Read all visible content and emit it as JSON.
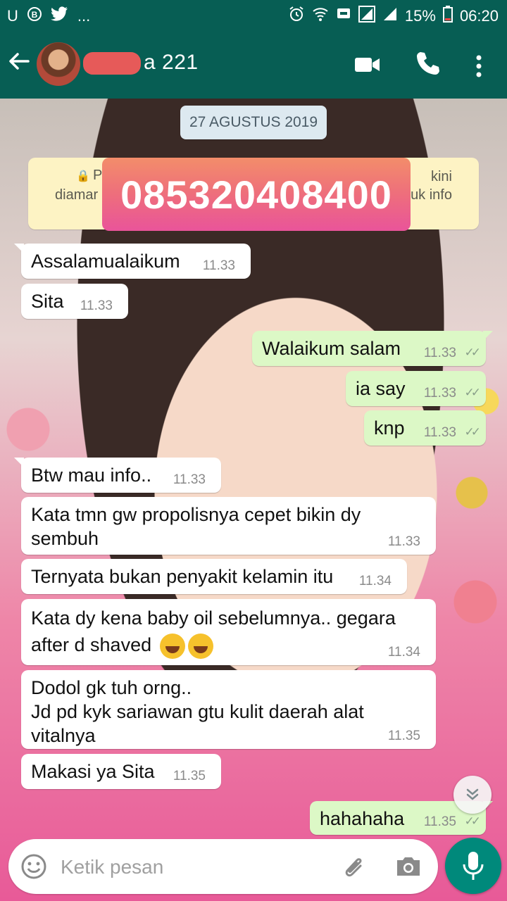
{
  "status_bar": {
    "left_icons": [
      "U",
      "B",
      "twitter-icon",
      "..."
    ],
    "battery": "15%",
    "time": "06:20"
  },
  "header": {
    "contact_name_visible": "a 221",
    "back_icon": "arrow-left-icon",
    "video_icon": "video-camera-icon",
    "call_icon": "phone-icon",
    "menu_icon": "more-vert-icon"
  },
  "date_chip": "27 AGUSTUS 2019",
  "encryption_notice": {
    "line1_left": "P",
    "line1_right": "kini",
    "line2_left": "diamar",
    "line2_right": "uk info"
  },
  "phone_banner": "085320408400",
  "messages": [
    {
      "dir": "in",
      "text": "Assalamualaikum",
      "time": "11.33"
    },
    {
      "dir": "in",
      "text": "Sita",
      "time": "11.33"
    },
    {
      "dir": "out",
      "text": "Walaikum salam",
      "time": "11.33"
    },
    {
      "dir": "out",
      "text": "ia say",
      "time": "11.33"
    },
    {
      "dir": "out",
      "text": "knp",
      "time": "11.33"
    },
    {
      "dir": "in",
      "text": "Btw mau info..",
      "time": "11.33"
    },
    {
      "dir": "in",
      "text": "Kata tmn gw propolisnya cepet bikin dy\nsembuh",
      "time": "11.33"
    },
    {
      "dir": "in",
      "text": "Ternyata bukan penyakit kelamin itu",
      "time": "11.34"
    },
    {
      "dir": "in",
      "text": "Kata dy kena baby oil sebelumnya.. gegara\nafter d shaved",
      "time": "11.34"
    },
    {
      "dir": "in",
      "text": "Dodol gk tuh orng..\nJd pd kyk sariawan gtu kulit daerah alat\nvitalnya",
      "time": "11.35"
    },
    {
      "dir": "in",
      "text": "Makasi ya Sita",
      "time": "11.35"
    },
    {
      "dir": "out",
      "text": "hahahaha",
      "time": "11.35"
    }
  ],
  "input_bar": {
    "placeholder": "Ketik pesan"
  },
  "colors": {
    "app_bar": "#075e54",
    "incoming_bubble": "#ffffff",
    "outgoing_bubble": "#dcf8c6",
    "mic_button": "#00897b"
  }
}
